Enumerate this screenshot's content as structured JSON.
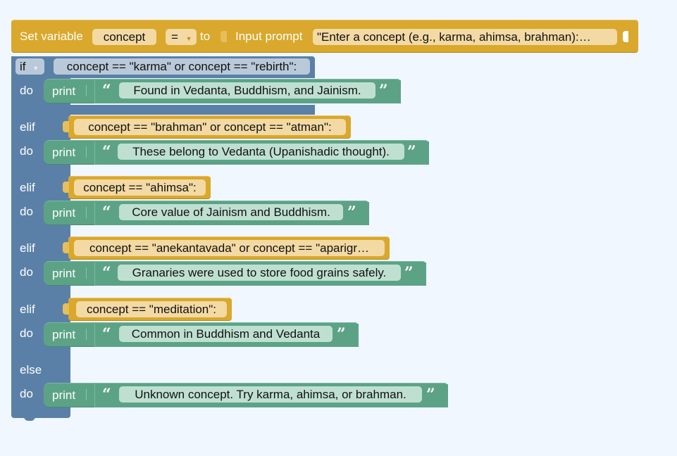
{
  "set_block": {
    "label": "Set variable",
    "variable": "concept",
    "operator": "=",
    "to_label": "to",
    "input_label": "Input prompt",
    "prompt_text": "\"Enter a concept (e.g., karma, ahimsa, brahman):…"
  },
  "if_block": {
    "if_label": "if",
    "condition": "concept == \"karma\" or concept == \"rebirth\":",
    "do_label": "do",
    "elif_label": "elif",
    "else_label": "else",
    "print_label": "print",
    "open_quote": "“",
    "close_quote": "”",
    "branches": [
      {
        "condition": "concept == \"karma\" or concept == \"rebirth\":",
        "message": "Found in Vedanta, Buddhism, and Jainism."
      },
      {
        "condition": "concept == \"brahman\" or concept == \"atman\":",
        "message": "These belong to Vedanta (Upanishadic thought)."
      },
      {
        "condition": "concept == \"ahimsa\":",
        "message": "Core value of Jainism and Buddhism."
      },
      {
        "condition": "concept == \"anekantavada\" or concept == \"aparigr…",
        "message": "Granaries were used to store food grains safely."
      },
      {
        "condition": "concept == \"meditation\":",
        "message": "Common in Buddhism and Vedanta"
      }
    ],
    "else_message": "Unknown concept. Try karma, ahimsa, or brahman."
  },
  "colors": {
    "variables": "#d9a82c",
    "logic": "#5a80a7",
    "text": "#5ca386",
    "workspace": "#f1f7fe"
  }
}
